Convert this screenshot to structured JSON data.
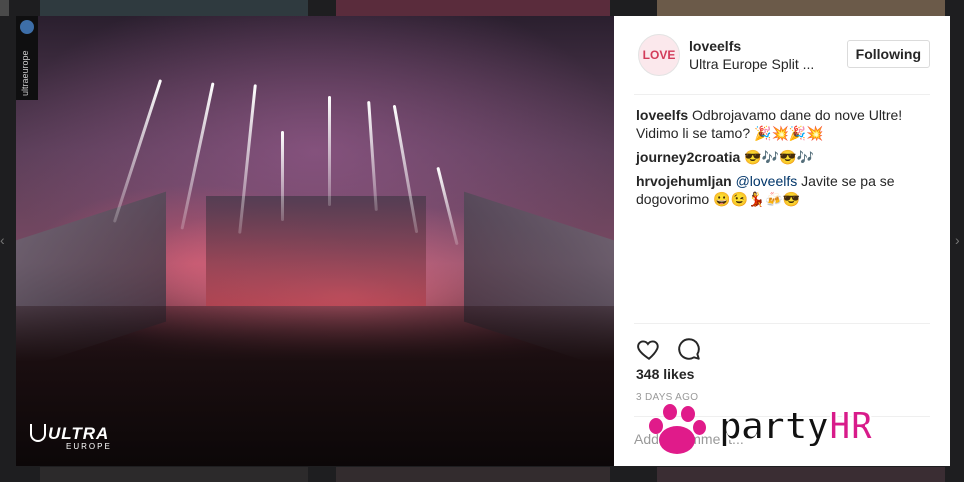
{
  "photo": {
    "watermark": "ultraeurope",
    "logo_word": "ULTRA",
    "logo_sub": "EUROPE"
  },
  "post": {
    "username": "loveelfs",
    "location": "Ultra Europe Split ...",
    "avatar_text": "LOVE",
    "follow_label": "Following"
  },
  "comments": [
    {
      "user": "loveelfs",
      "text": "Odbrojavamo dane do nove Ultre! Vidimo li se tamo? 🎉💥🎉💥",
      "mention": ""
    },
    {
      "user": "journey2croatia",
      "text": "😎🎶😎🎶",
      "mention": ""
    },
    {
      "user": "hrvojehumljan",
      "mention": "@loveelfs",
      "text": "Javite se pa se dogovorimo 😀😉💃🍻😎"
    }
  ],
  "stats": {
    "likes": "348 likes",
    "timestamp": "3 DAYS AGO"
  },
  "add_comment": {
    "placeholder": "Add a comment..."
  },
  "overlay_logo": {
    "word": "party",
    "accent": "HR",
    "accent_color": "#d81b8a"
  },
  "icons": {
    "like": "heart-icon",
    "comment": "comment-bubble-icon",
    "paw": "paw-icon"
  }
}
